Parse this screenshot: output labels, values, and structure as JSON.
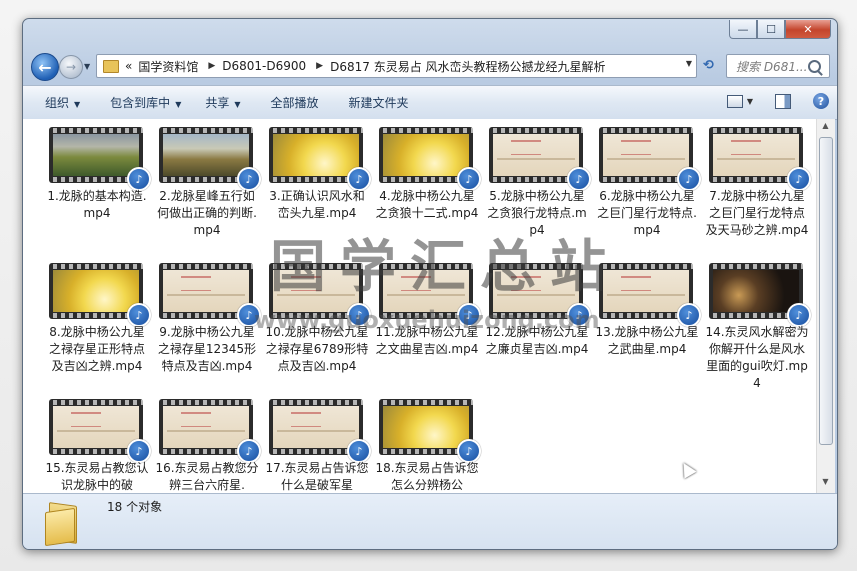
{
  "window": {
    "close_glyph": "✕",
    "maximize_glyph": "☐",
    "minimize_glyph": "—"
  },
  "address": {
    "prefix": "«",
    "crumbs": [
      "国学资料馆",
      "D6801-D6900",
      "D6817 东灵易占 风水峦头教程杨公撼龙经九星解析"
    ],
    "separator": "▶"
  },
  "search": {
    "placeholder": "搜索 D681..."
  },
  "toolbar": {
    "organize": "组织",
    "include_library": "包含到库中",
    "share": "共享",
    "play_all": "全部播放",
    "new_folder": "新建文件夹"
  },
  "files": [
    {
      "name": "1.龙脉的基本构造.mp4",
      "thumb": "landscape"
    },
    {
      "name": "2.龙脉星峰五行如何做出正确的判断.mp4",
      "thumb": "landscape2"
    },
    {
      "name": "3.正确认识风水和峦头九星.mp4",
      "thumb": "gold"
    },
    {
      "name": "4.龙脉中杨公九星之贪狼十二式.mp4",
      "thumb": "gold"
    },
    {
      "name": "5.龙脉中杨公九星之贪狼行龙特点.mp4",
      "thumb": "scroll"
    },
    {
      "name": "6.龙脉中杨公九星之巨门星行龙特点.mp4",
      "thumb": "scroll"
    },
    {
      "name": "7.龙脉中杨公九星之巨门星行龙特点及天马砂之辨.mp4",
      "thumb": "scroll"
    },
    {
      "name": "8.龙脉中杨公九星之禄存星正形特点及吉凶之辨.mp4",
      "thumb": "gold"
    },
    {
      "name": "9.龙脉中杨公九星之禄存星12345形特点及吉凶.mp4",
      "thumb": "scroll"
    },
    {
      "name": "10.龙脉中杨公九星之禄存星6789形特点及吉凶.mp4",
      "thumb": "scroll"
    },
    {
      "name": "11.龙脉中杨公九星之文曲星吉凶.mp4",
      "thumb": "scroll"
    },
    {
      "name": "12.龙脉中杨公九星之廉贞星吉凶.mp4",
      "thumb": "scroll"
    },
    {
      "name": "13.龙脉中杨公九星之武曲星.mp4",
      "thumb": "scroll"
    },
    {
      "name": "14.东灵风水解密为你解开什么是风水里面的gui吹灯.mp4",
      "thumb": "dark"
    },
    {
      "name": "15.东灵易占教您认识龙脉中的破",
      "thumb": "scroll"
    },
    {
      "name": "16.东灵易占教您分辨三台六府星.",
      "thumb": "scroll"
    },
    {
      "name": "17.东灵易占告诉您什么是破军星",
      "thumb": "scroll"
    },
    {
      "name": "18.东灵易占告诉您怎么分辨杨公",
      "thumb": "gold"
    }
  ],
  "status": {
    "count_text": "18 个对象"
  },
  "watermark": {
    "text": "国学汇总站",
    "url": "www.guoxuehuizong.com"
  },
  "colors": {
    "accent": "#1f5fb4",
    "toolbar_text": "#1e395b"
  }
}
